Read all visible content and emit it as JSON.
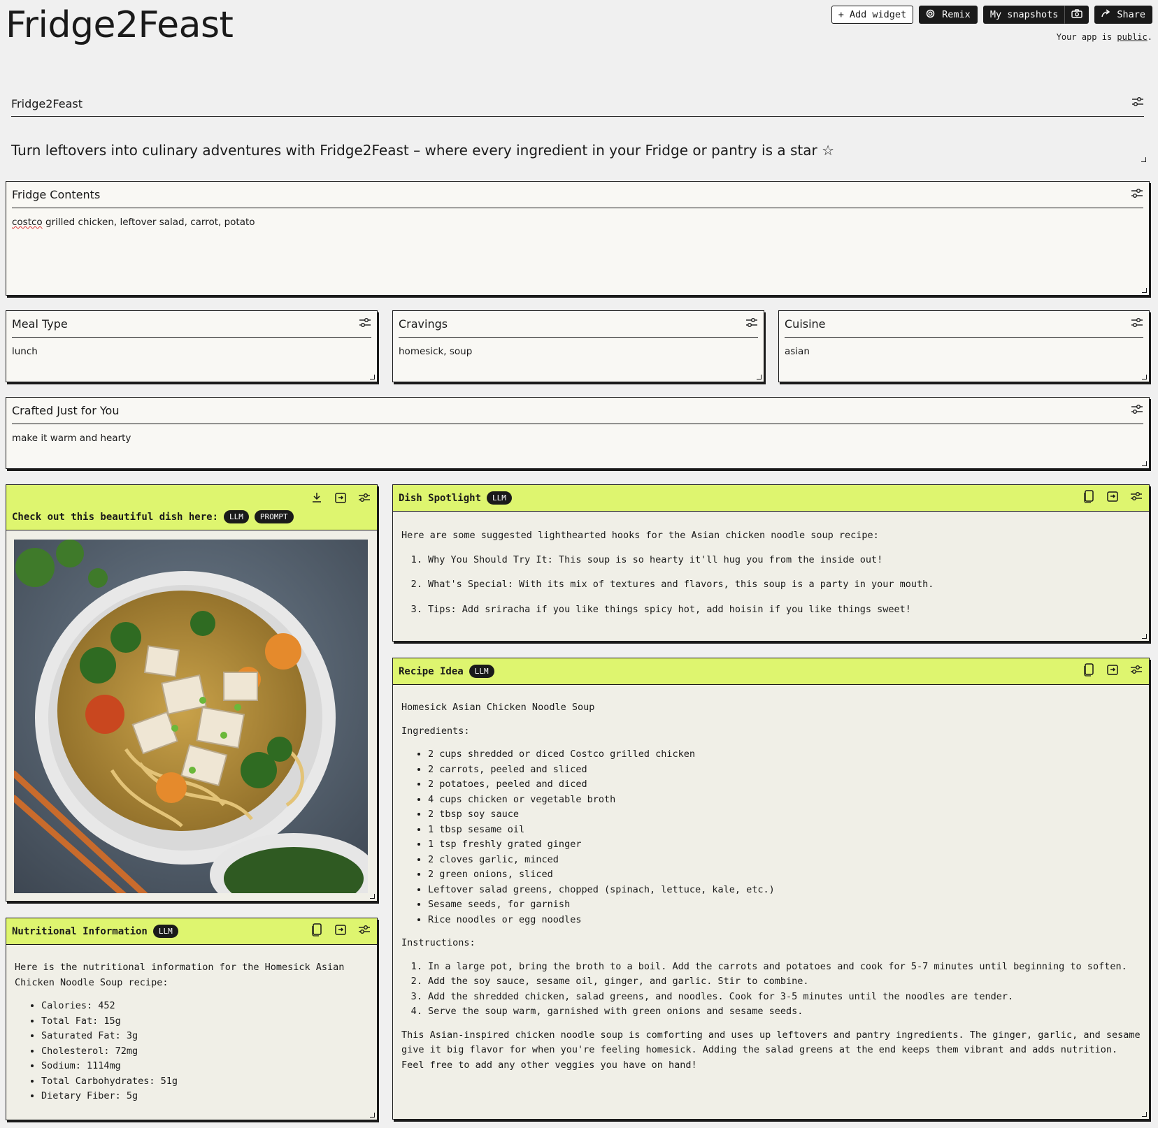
{
  "app": {
    "title": "Fridge2Feast",
    "public_prefix": "Your app is ",
    "public_link": "public",
    "public_suffix": "."
  },
  "topbar": {
    "add_widget": "Add widget",
    "remix": "Remix",
    "my_snapshots": "My snapshots",
    "share": "Share"
  },
  "header": {
    "title": "Fridge2Feast",
    "tagline": "Turn leftovers into culinary adventures with Fridge2Feast – where every ingredient in your Fridge or pantry is a star ☆"
  },
  "fridge": {
    "title": "Fridge Contents",
    "value_misspelled": "costco",
    "value_rest": " grilled chicken, leftover salad, carrot, potato"
  },
  "meal_type": {
    "title": "Meal Type",
    "value": "lunch"
  },
  "cravings": {
    "title": "Cravings",
    "value": "homesick, soup"
  },
  "cuisine": {
    "title": "Cuisine",
    "value": "asian"
  },
  "crafted": {
    "title": "Crafted Just for You",
    "value": "make it warm and hearty"
  },
  "image_panel": {
    "title": "Check out this beautiful dish here:",
    "badges": [
      "LLM",
      "PROMPT"
    ]
  },
  "spotlight": {
    "title": "Dish Spotlight",
    "badge": "LLM",
    "intro": "Here are some suggested lighthearted hooks for the Asian chicken noodle soup recipe:",
    "items": [
      "Why You Should Try It: This soup is so hearty it'll hug you from the inside out!",
      "What's Special: With its mix of textures and flavors, this soup is a party in your mouth.",
      "Tips: Add sriracha if you like things spicy hot, add hoisin if you like things sweet!"
    ]
  },
  "recipe": {
    "title": "Recipe Idea",
    "badge": "LLM",
    "name": "Homesick Asian Chicken Noodle Soup",
    "ingredients_label": "Ingredients:",
    "ingredients": [
      "2 cups shredded or diced Costco grilled chicken",
      "2 carrots, peeled and sliced",
      "2 potatoes, peeled and diced",
      "4 cups chicken or vegetable broth",
      "2 tbsp soy sauce",
      "1 tbsp sesame oil",
      "1 tsp freshly grated ginger",
      "2 cloves garlic, minced",
      "2 green onions, sliced",
      "Leftover salad greens, chopped (spinach, lettuce, kale, etc.)",
      "Sesame seeds, for garnish",
      "Rice noodles or egg noodles"
    ],
    "instructions_label": "Instructions:",
    "instructions": [
      "In a large pot, bring the broth to a boil. Add the carrots and potatoes and cook for 5-7 minutes until beginning to soften.",
      "Add the soy sauce, sesame oil, ginger, and garlic. Stir to combine.",
      "Add the shredded chicken, salad greens, and noodles. Cook for 3-5 minutes until the noodles are tender.",
      "Serve the soup warm, garnished with green onions and sesame seeds."
    ],
    "outro": "This Asian-inspired chicken noodle soup is comforting and uses up leftovers and pantry ingredients. The ginger, garlic, and sesame give it big flavor for when you're feeling homesick. Adding the salad greens at the end keeps them vibrant and adds nutrition. Feel free to add any other veggies you have on hand!"
  },
  "nutrition": {
    "title": "Nutritional Information",
    "badge": "LLM",
    "intro": "Here is the nutritional information for the Homesick Asian Chicken Noodle Soup recipe:",
    "items": [
      "Calories: 452",
      "Total Fat: 15g",
      "Saturated Fat: 3g",
      "Cholesterol: 72mg",
      "Sodium: 1114mg",
      "Total Carbohydrates: 51g",
      "Dietary Fiber: 5g"
    ]
  },
  "colors": {
    "accent": "#def56f",
    "ink": "#1a1a1a",
    "background": "#f0f0f0"
  }
}
